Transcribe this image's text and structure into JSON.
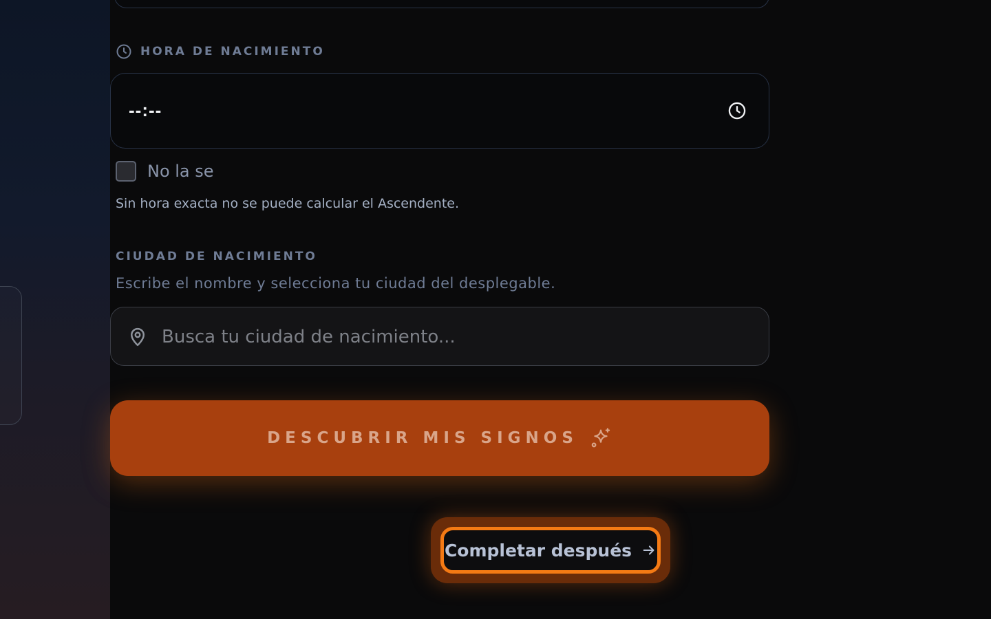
{
  "hora": {
    "label": "HORA DE NACIMIENTO",
    "value": "--:--",
    "clock_icon": "clock-icon"
  },
  "unknown": {
    "label": "No la se",
    "checked": false
  },
  "hint": "Sin hora exacta no se puede calcular el Ascendente.",
  "ciudad": {
    "label": "CIUDAD DE NACIMIENTO",
    "help": "Escribe el nombre y selecciona tu ciudad del desplegable.",
    "placeholder": "Busca tu ciudad de nacimiento...",
    "value": "",
    "pin_icon": "map-pin-icon"
  },
  "cta": {
    "label": "DESCUBRIR MIS SIGNOS",
    "icon": "sparkles-icon",
    "color": "#a8400e"
  },
  "later": {
    "label": "Completar después",
    "icon": "arrow-right-icon",
    "focus_color": "#f47a14"
  }
}
